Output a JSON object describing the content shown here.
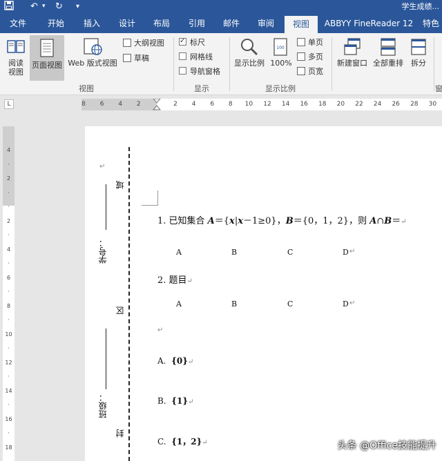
{
  "titlebar": {
    "save_icon": "save-icon",
    "undo_icon": "undo-icon",
    "redo_icon": "redo-icon",
    "customize_icon": "customize-qat-icon",
    "doc_title": "学生成绩..."
  },
  "tabs": [
    {
      "label": "文件"
    },
    {
      "label": "开始"
    },
    {
      "label": "插入"
    },
    {
      "label": "设计"
    },
    {
      "label": "布局"
    },
    {
      "label": "引用"
    },
    {
      "label": "邮件"
    },
    {
      "label": "审阅"
    },
    {
      "label": "视图",
      "active": true
    },
    {
      "label": "ABBYY FineReader 12"
    },
    {
      "label": "特色"
    }
  ],
  "ribbon": {
    "views": {
      "read_mode": "阅读\n视图",
      "print_layout": "页面视图",
      "web_layout": "Web 版式视图",
      "outline": "大纲视图",
      "draft": "草稿",
      "group_label": "视图"
    },
    "show": {
      "ruler": {
        "label": "标尺",
        "checked": true
      },
      "gridlines": {
        "label": "网格线",
        "checked": false
      },
      "nav_pane": {
        "label": "导航窗格",
        "checked": false
      },
      "group_label": "显示"
    },
    "zoom": {
      "zoom": "显示比例",
      "hundred": "100%",
      "one_page": "单页",
      "multi_page": "多页",
      "page_width": "页宽",
      "group_label": "显示比例"
    },
    "window": {
      "new_window": "新建窗口",
      "arrange_all": "全部重排",
      "split": "拆分",
      "group_label": "窗口"
    }
  },
  "ruler": {
    "tab_selector": "L",
    "ticks": [
      "8",
      "6",
      "4",
      "2",
      "",
      "2",
      "4",
      "6",
      "8",
      "10",
      "12",
      "14",
      "16",
      "18",
      "20",
      "22",
      "24",
      "26",
      "28",
      "30"
    ],
    "vticks": [
      "4",
      "",
      "2",
      "",
      "",
      "2",
      "",
      "4",
      "",
      "6",
      "",
      "8",
      "",
      "10",
      "",
      "12",
      "",
      "14",
      "",
      "16",
      "",
      "18"
    ]
  },
  "document": {
    "binding_line": {
      "xue_hao": "学号：",
      "ban_ji": "班级：",
      "yu": "域",
      "qu": "区",
      "feng": "封"
    },
    "q1": {
      "prefix": "1. 已知集合 ",
      "set_a": "A",
      "eq1": "＝{",
      "x1": "x",
      "bar": "|",
      "x2": "x",
      "cond": "－1≥0}",
      "comma": "，",
      "set_b": "B",
      "eq2": "＝{0，1，2}",
      "then": "，则 ",
      "a2": "A",
      "cap": "∩",
      "b2": "B",
      "tail": "＝"
    },
    "q1_options": [
      "A",
      "B",
      "C",
      "D"
    ],
    "q2": "2. 题目",
    "q2_options": [
      "A",
      "B",
      "C",
      "D"
    ],
    "answers": [
      {
        "letter": "A.",
        "value": "{0}"
      },
      {
        "letter": "B.",
        "value": "{1}"
      },
      {
        "letter": "C.",
        "value": "{1，2}"
      }
    ],
    "para_mark": "↵"
  },
  "watermark": "头条 @Office技能提升"
}
